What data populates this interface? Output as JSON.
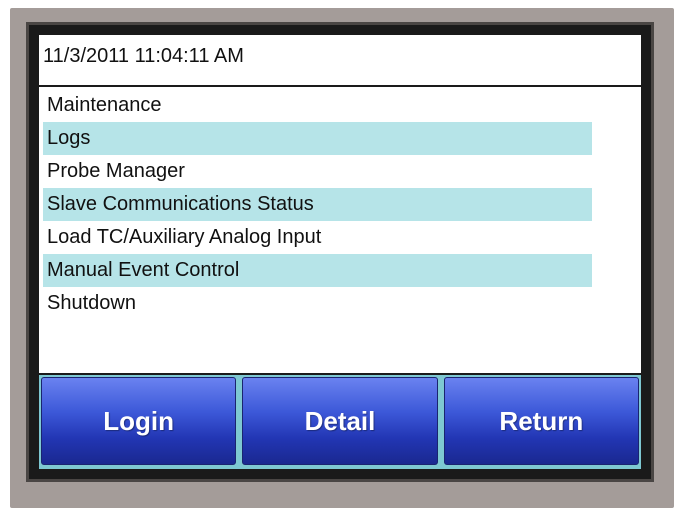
{
  "header": {
    "datetime": "11/3/2011 11:04:11 AM"
  },
  "menu": {
    "items": [
      {
        "label": "Maintenance",
        "shaded": false
      },
      {
        "label": "Logs",
        "shaded": true
      },
      {
        "label": "Probe Manager",
        "shaded": false
      },
      {
        "label": "Slave Communications Status",
        "shaded": true
      },
      {
        "label": "Load TC/Auxiliary Analog Input",
        "shaded": false
      },
      {
        "label": "Manual Event Control",
        "shaded": true
      },
      {
        "label": "Shutdown",
        "shaded": false
      }
    ]
  },
  "buttons": {
    "login": "Login",
    "detail": "Detail",
    "return": "Return"
  },
  "colors": {
    "bezel": "#a49c99",
    "row_highlight": "#b6e4e8",
    "button_bar": "#7ec8d2",
    "button_blue": "#2236b4"
  }
}
